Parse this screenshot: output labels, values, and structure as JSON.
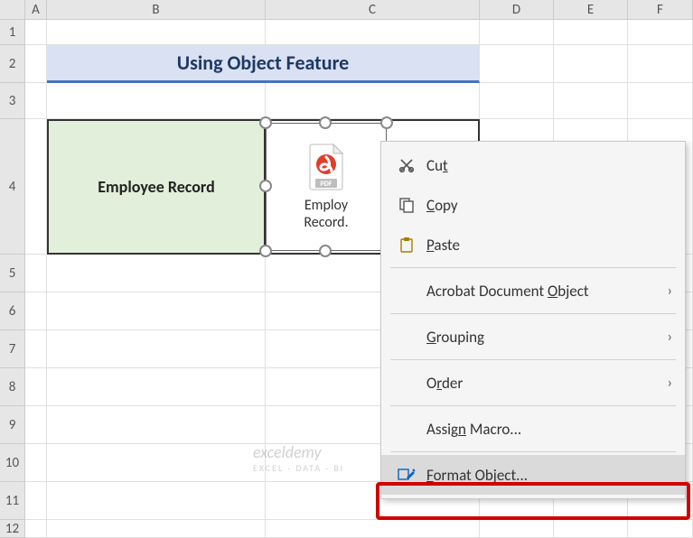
{
  "columns": [
    "A",
    "B",
    "C",
    "D",
    "E",
    "F"
  ],
  "row_numbers": [
    "1",
    "2",
    "3",
    "4",
    "5",
    "6",
    "7",
    "8",
    "9",
    "10",
    "11",
    "12"
  ],
  "title": "Using Object Feature",
  "employee_label": "Employee Record",
  "object_filename_line1": "Employ",
  "object_filename_line2": "Record.",
  "pdf_badge": "PDF",
  "menu": {
    "cut": "Cut",
    "copy": "Copy",
    "paste": "Paste",
    "acrobat": "Acrobat Document Object",
    "grouping": "Grouping",
    "order": "Order",
    "assign_macro": "Assign Macro...",
    "format_object": "Format Object..."
  },
  "watermark": {
    "brand": "exceldemy",
    "tag": "EXCEL · DATA · BI"
  }
}
